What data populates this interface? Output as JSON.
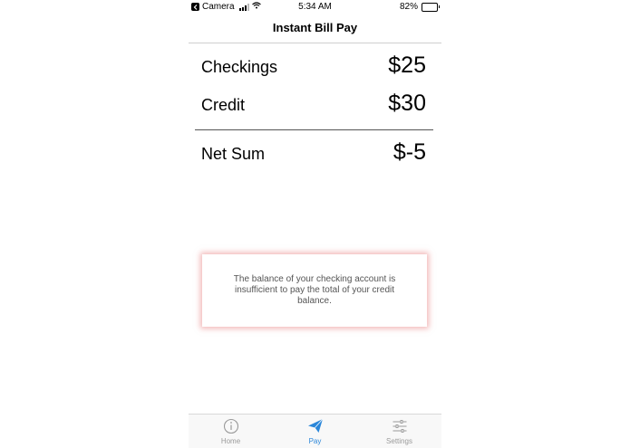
{
  "status_bar": {
    "back_app": "Camera",
    "time": "5:34 AM",
    "battery": "82%",
    "battery_level": 0.82
  },
  "nav": {
    "title": "Instant Bill Pay"
  },
  "balances": {
    "checkings": {
      "label": "Checkings",
      "value": "$25"
    },
    "credit": {
      "label": "Credit",
      "value": "$30"
    },
    "net": {
      "label": "Net Sum",
      "value": "$-5"
    }
  },
  "alert": {
    "message": "The balance of your checking account is insufficient to pay the total of your credit balance."
  },
  "tabs": [
    {
      "label": "Home",
      "icon": "info-icon",
      "active": false
    },
    {
      "label": "Pay",
      "icon": "paper-plane-icon",
      "active": true
    },
    {
      "label": "Settings",
      "icon": "sliders-icon",
      "active": false
    }
  ],
  "colors": {
    "accent": "#2a86d9",
    "inactive": "#9a9a9a",
    "alert_glow": "#e67878"
  }
}
